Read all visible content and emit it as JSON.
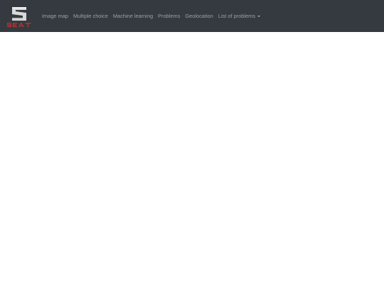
{
  "navbar": {
    "brand": {
      "logo_icon": "seat-logo-icon",
      "wordmark": "SEAT",
      "colors": {
        "mark": "#d9d9d9",
        "wordmark": "#c0302c"
      }
    },
    "items": [
      {
        "label": "Image map"
      },
      {
        "label": "Multiple choice"
      },
      {
        "label": "Machine learning"
      },
      {
        "label": "Problems"
      },
      {
        "label": "Geolocation"
      },
      {
        "label": "List of problems",
        "dropdown_icon": "caret-down-icon"
      }
    ],
    "colors": {
      "background": "#343a40",
      "link": "rgba(255,255,255,0.5)"
    }
  }
}
